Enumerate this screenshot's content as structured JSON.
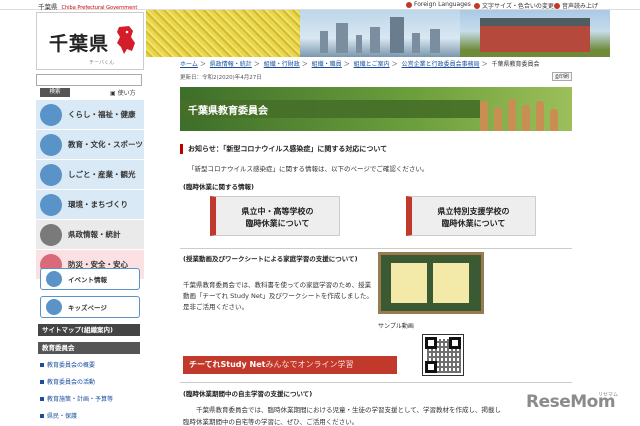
{
  "topbar": {
    "gov_jp": "千葉県",
    "gov_en": "Chiba Prefectural Government",
    "foreign": "Foreign Languages",
    "textsize": "文字サイズ・色合いの変更",
    "voice": "音声読み上げ"
  },
  "logo": {
    "title": "千葉県",
    "sub": "チーバくん"
  },
  "search": {
    "button": "検索",
    "help": "使い方"
  },
  "nav": [
    {
      "label": "くらし・福祉・健康"
    },
    {
      "label": "教育・文化・スポーツ"
    },
    {
      "label": "しごと・産業・観光"
    },
    {
      "label": "環境・まちづくり"
    },
    {
      "label": "県政情報・統計"
    },
    {
      "label": "防災・安全・安心"
    }
  ],
  "sub_buttons": {
    "event": "イベント情報",
    "kids": "キッズページ"
  },
  "sitemap": "サイトマップ(組織案内)",
  "board": {
    "heading": "教育委員会",
    "links": [
      "教育委員会の概要",
      "教育委員会の活動",
      "教育施策・計画・予算等",
      "県民・保護"
    ]
  },
  "breadcrumb": [
    "ホーム",
    "県政情報・統計",
    "組織・行財政",
    "組織・職員",
    "組織とご案内",
    "公営企業と行政委員会事務局",
    "千葉県教育委員会"
  ],
  "updated": "更新日：令和2(2020)年4月27日",
  "print_label": "印刷",
  "page_title": "千葉県教育委員会",
  "notice": "お知らせ：「新型コロナウイルス感染症」に関する対応について",
  "intro": "「新型コロナウイルス感染症」に関する情報は、以下のページでご確認ください。",
  "closure_heading": "(臨時休業に関する情報)",
  "closure_buttons": [
    {
      "line1": "県立中・高等学校の",
      "line2": "臨時休業について"
    },
    {
      "line1": "県立特別支援学校の",
      "line2": "臨時休業について"
    }
  ],
  "support_heading": "(授業動画及びワークシートによる家庭学習の支援について)",
  "support_text": "千葉県教育委員会では、教科書を使っての家庭学習のため、授業動画「チーてれ Study Net」及びワークシートを作成しました。是非ご活用ください。",
  "sample_label": "サンプル動画",
  "net_banner": {
    "main": "チーてれStudy Net",
    "tail": "みんなでオンライン学習"
  },
  "home_heading": "(臨時休業期間中の自主学習の支援について)",
  "home_text_1": "千葉県教育委員会では、臨時休業期間における児童・生徒の学習支援として、学習教材を作成し、掲載し",
  "home_text_2": "臨時休業期間中の自宅等の学習に、ぜひ、ご活用ください。",
  "watermark": {
    "main": "ReseMom",
    "small": "リセマム"
  }
}
